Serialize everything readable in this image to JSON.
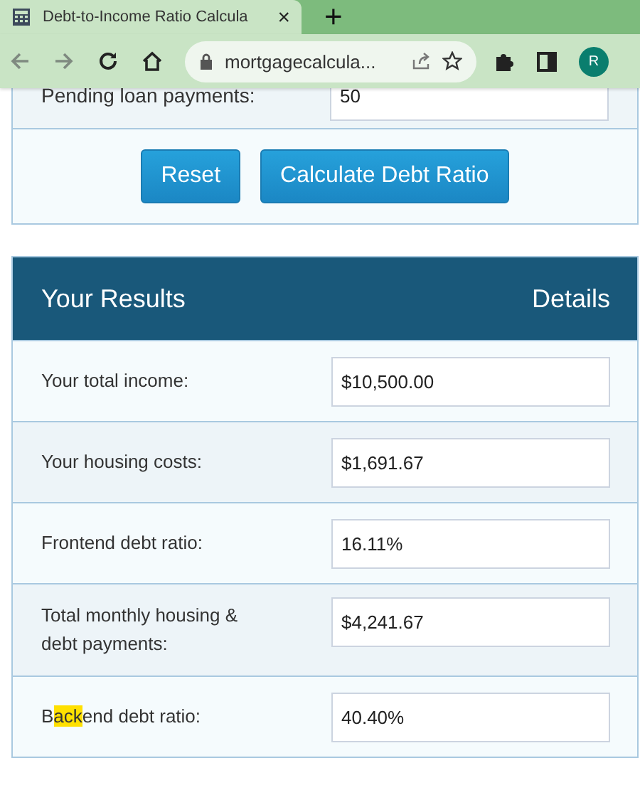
{
  "browser": {
    "tab": {
      "title": "Debt-to-Income Ratio Calcula",
      "close": "×"
    },
    "new_tab": "+",
    "address": "mortgagecalcula...",
    "profile": "R"
  },
  "form": {
    "partial_row": {
      "label": "Pending loan payments:",
      "value": "50"
    },
    "buttons": [
      "Reset",
      "Calculate Debt Ratio"
    ]
  },
  "results": {
    "title": "Your Results",
    "details": "Details",
    "rows": [
      {
        "label_parts": [
          {
            "text": "Your total income:",
            "highlighted": false
          }
        ],
        "value": "$10,500.00"
      },
      {
        "label_parts": [
          {
            "text": "Your housing costs:",
            "highlighted": false
          }
        ],
        "value": "$1,691.67"
      },
      {
        "label_parts": [
          {
            "text": "Frontend debt ratio:",
            "highlighted": false
          }
        ],
        "value": "16.11%"
      },
      {
        "label_parts": [
          {
            "text": "Total monthly housing & debt payments:",
            "highlighted": false
          }
        ],
        "value": "$4,241.67"
      },
      {
        "label_parts": [
          {
            "text": "B",
            "highlighted": false
          },
          {
            "text": "ack",
            "highlighted": true
          },
          {
            "text": "end debt ratio:",
            "highlighted": false
          }
        ],
        "value": "40.40%"
      }
    ]
  }
}
